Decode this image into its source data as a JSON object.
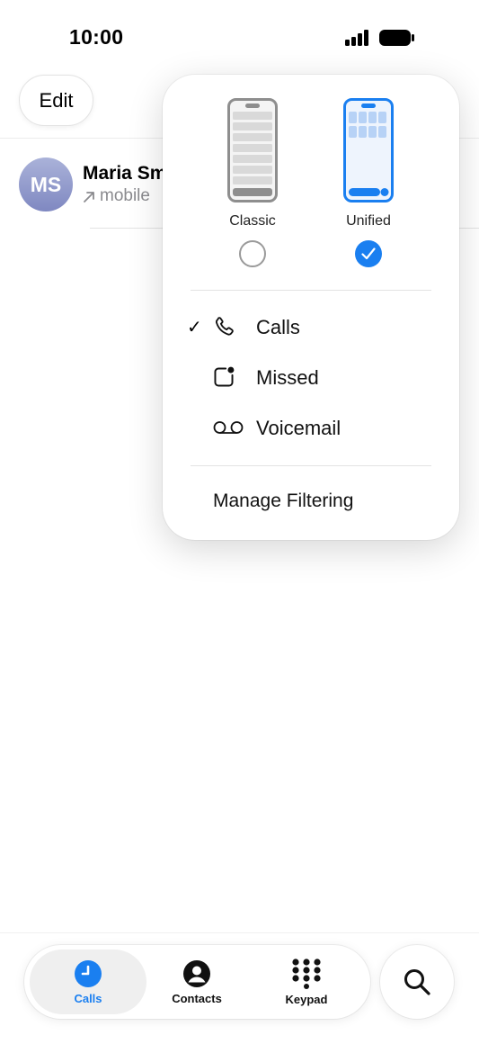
{
  "status_bar": {
    "time": "10:00",
    "icons": [
      "signal-icon",
      "battery-icon"
    ]
  },
  "header": {
    "edit_label": "Edit"
  },
  "calls": [
    {
      "initials": "MS",
      "name": "Maria Sm",
      "type": "mobile",
      "icon": "outgoing-arrow-icon"
    }
  ],
  "popover": {
    "layouts": [
      {
        "label": "Classic",
        "selected": false
      },
      {
        "label": "Unified",
        "selected": true
      }
    ],
    "filters": [
      {
        "label": "Calls",
        "icon": "phone-icon",
        "checked": true
      },
      {
        "label": "Missed",
        "icon": "missed-badge-icon",
        "checked": false
      },
      {
        "label": "Voicemail",
        "icon": "voicemail-icon",
        "checked": false
      }
    ],
    "check_glyph": "✓",
    "manage_label": "Manage Filtering"
  },
  "tab_bar": {
    "tabs": [
      {
        "label": "Calls",
        "icon": "clock-icon",
        "active": true
      },
      {
        "label": "Contacts",
        "icon": "person-circle-icon",
        "active": false
      },
      {
        "label": "Keypad",
        "icon": "keypad-icon",
        "active": false
      }
    ],
    "search_icon": "search-icon"
  },
  "colors": {
    "accent": "#1a7ff0",
    "secondary_text": "#8a8a8e",
    "avatar_gradient": [
      "#aab2d9",
      "#7f88c1"
    ]
  }
}
